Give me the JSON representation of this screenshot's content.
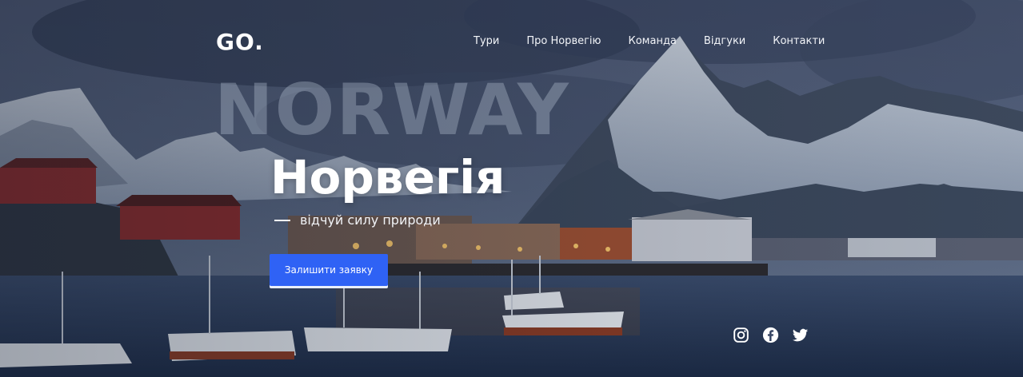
{
  "header": {
    "logo": "GO.",
    "nav": [
      "Тури",
      "Про Норвегію",
      "Команда",
      "Відгуки",
      "Контакти"
    ]
  },
  "hero": {
    "background_word": "NORWAY",
    "title": "Норвегія",
    "tagline": "відчуй силу природи",
    "cta_label": "Залишити заявку"
  },
  "socials": [
    "instagram-icon",
    "facebook-icon",
    "twitter-icon"
  ],
  "colors": {
    "accent": "#2f62f5",
    "text": "#ffffff"
  }
}
